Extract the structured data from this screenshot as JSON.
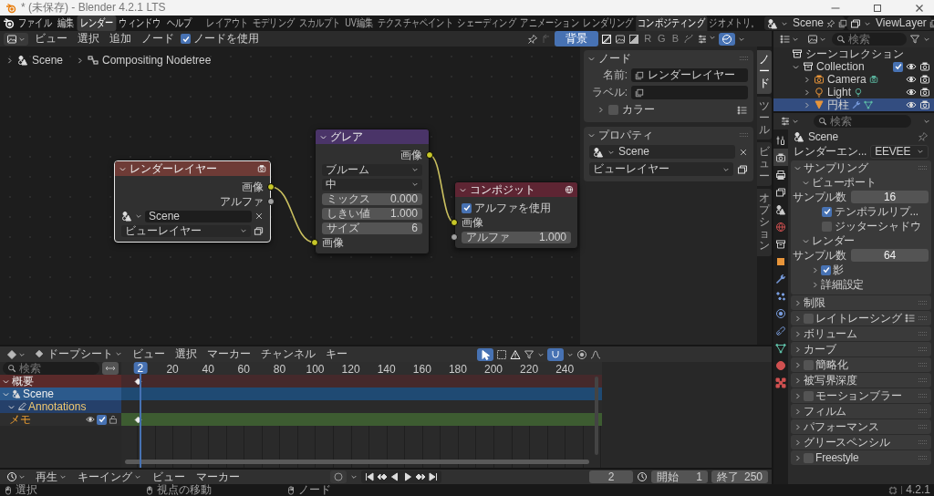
{
  "window": {
    "title": "* (未保存) - Blender 4.2.1 LTS"
  },
  "menu": [
    {
      "label": "ファイル",
      "selected": false
    },
    {
      "label": "編集",
      "selected": false
    },
    {
      "label": "レンダー",
      "selected": true
    },
    {
      "label": "ウィンドウ",
      "selected": false
    },
    {
      "label": "ヘルプ",
      "selected": false
    }
  ],
  "workspaces": [
    {
      "label": "レイアウト",
      "selected": false
    },
    {
      "label": "モデリング",
      "selected": false
    },
    {
      "label": "スカルプト",
      "selected": false
    },
    {
      "label": "UV編集",
      "selected": false
    },
    {
      "label": "テクスチャペイント",
      "selected": false
    },
    {
      "label": "シェーディング",
      "selected": false
    },
    {
      "label": "アニメーション",
      "selected": false
    },
    {
      "label": "レンダリング",
      "selected": false
    },
    {
      "label": "コンポジティング",
      "selected": true
    },
    {
      "label": "ジオメトリ。",
      "selected": false
    }
  ],
  "scene_selector": {
    "value": "Scene"
  },
  "view_layer_selector": {
    "value": "ViewLayer"
  },
  "node_editor": {
    "menu": [
      "ビュー",
      "選択",
      "追加",
      "ノード"
    ],
    "use_nodes": {
      "label": "ノードを使用",
      "checked": true
    },
    "backdrop": {
      "label": "背景",
      "on": true
    },
    "channel_buttons": [
      {
        "label": "R"
      },
      {
        "label": "G"
      },
      {
        "label": "B"
      }
    ],
    "breadcrumbs": [
      "Scene",
      "Compositing Nodetree"
    ],
    "nodes": [
      {
        "kind": "render_layers",
        "title": "レンダーレイヤー",
        "color": "#6e3b36",
        "selected": true,
        "rows": [
          {
            "kind": "output",
            "label": "画像",
            "connected": true,
            "color": "#c7c729"
          },
          {
            "kind": "output",
            "label": "アルファ",
            "connected": false,
            "color": "#a1a1a1"
          },
          {
            "kind": "scene",
            "value": "Scene"
          },
          {
            "kind": "dropdown",
            "value": "ビューレイヤー"
          }
        ]
      },
      {
        "kind": "glare",
        "title": "グレア",
        "color": "#4a3468",
        "selected": false,
        "rows": [
          {
            "kind": "output",
            "label": "画像",
            "connected": true,
            "color": "#c7c729"
          },
          {
            "kind": "dropdown",
            "value": "ブルーム"
          },
          {
            "kind": "dropdown",
            "value": "中"
          },
          {
            "kind": "number",
            "label": "ミックス",
            "value": "0.000"
          },
          {
            "kind": "number",
            "label": "しきい値",
            "value": "1.000"
          },
          {
            "kind": "number",
            "label": "サイズ",
            "value": "6"
          },
          {
            "kind": "input",
            "label": "画像",
            "connected": true,
            "color": "#c7c729"
          }
        ]
      },
      {
        "kind": "composite",
        "title": "コンポジット",
        "color": "#5e2533",
        "selected": false,
        "rows": [
          {
            "kind": "checkbox",
            "label": "アルファを使用",
            "checked": true
          },
          {
            "kind": "input",
            "label": "画像",
            "connected": true,
            "color": "#c7c729"
          },
          {
            "kind": "number_input",
            "label": "アルファ",
            "value": "1.000",
            "color": "#a1a1a1"
          }
        ]
      }
    ]
  },
  "sidebar": {
    "tabs": [
      {
        "label": "ノード",
        "selected": true
      },
      {
        "label": "ツール",
        "selected": false
      },
      {
        "label": "ビュー",
        "selected": false
      },
      {
        "label": "オプション",
        "selected": false
      }
    ],
    "node_panel": {
      "title": "ノード",
      "name_label": "名前:",
      "name": "レンダーレイヤー",
      "label_label": "ラベル:",
      "color_label": "カラー",
      "color_checked": false
    },
    "properties_panel": {
      "title": "プロパティ",
      "scene": "Scene",
      "view_layer": "ビューレイヤー"
    }
  },
  "outliner": {
    "search_placeholder": "検索",
    "root": "シーンコレクション",
    "items": [
      {
        "label": "Collection",
        "kind": "collection",
        "expanded": true,
        "checked": true,
        "selected": false,
        "visible": true,
        "renderable": true,
        "children": [
          {
            "label": "Camera",
            "kind": "camera",
            "expanded": false,
            "selected": false,
            "visible": true,
            "renderable": true
          },
          {
            "label": "Light",
            "kind": "light",
            "expanded": false,
            "selected": false,
            "visible": true,
            "renderable": true
          },
          {
            "label": "円柱",
            "kind": "mesh",
            "expanded": false,
            "selected": true,
            "visible": true,
            "renderable": true
          }
        ]
      }
    ]
  },
  "properties": {
    "search_placeholder": "検索",
    "tabs": [
      {
        "kind": "tool",
        "selected": false
      },
      {
        "kind": "render",
        "selected": true
      },
      {
        "kind": "output",
        "selected": false
      },
      {
        "kind": "view_layer",
        "selected": false
      },
      {
        "kind": "scene",
        "selected": false
      },
      {
        "kind": "world",
        "selected": false
      },
      {
        "kind": "collection",
        "selected": false
      },
      {
        "kind": "object",
        "selected": false
      },
      {
        "kind": "modifiers",
        "selected": false
      },
      {
        "kind": "particles",
        "selected": false
      },
      {
        "kind": "physics",
        "selected": false
      },
      {
        "kind": "constraints",
        "selected": false
      },
      {
        "kind": "data",
        "selected": false
      },
      {
        "kind": "material",
        "selected": false
      },
      {
        "kind": "texture",
        "selected": false
      }
    ],
    "context": "Scene",
    "engine_label": "レンダーエン...",
    "engine": "EEVEE",
    "panels": [
      {
        "kind": "panel",
        "title": "サンプリング",
        "expanded": true,
        "presets": false,
        "children": [
          {
            "kind": "subpanel",
            "title": "ビューポート",
            "expanded": true,
            "children": [
              {
                "kind": "number",
                "label": "サンプル数",
                "value": "16"
              },
              {
                "kind": "checkbox",
                "label": "テンポラルリプ...",
                "checked": true
              },
              {
                "kind": "checkbox",
                "label": "ジッターシャドウ",
                "checked": false
              }
            ]
          },
          {
            "kind": "subpanel",
            "title": "レンダー",
            "expanded": true,
            "children": [
              {
                "kind": "number",
                "label": "サンプル数",
                "value": "64"
              },
              {
                "kind": "subpanel",
                "title": "影",
                "expanded": false,
                "checked": true
              },
              {
                "kind": "subpanel",
                "title": "詳細設定",
                "expanded": false
              }
            ]
          }
        ]
      },
      {
        "kind": "panel",
        "title": "制限",
        "expanded": false,
        "presets": false
      },
      {
        "kind": "panel",
        "title": "レイトレーシング",
        "expanded": false,
        "checked": false,
        "presets": true
      },
      {
        "kind": "panel",
        "title": "ボリューム",
        "expanded": false,
        "presets": false
      },
      {
        "kind": "panel",
        "title": "カーブ",
        "expanded": false,
        "presets": false
      },
      {
        "kind": "panel",
        "title": "簡略化",
        "expanded": false,
        "checked": false,
        "presets": false
      },
      {
        "kind": "panel",
        "title": "被写界深度",
        "expanded": false,
        "presets": false
      },
      {
        "kind": "panel",
        "title": "モーションブラー",
        "expanded": false,
        "checked": false,
        "presets": false
      },
      {
        "kind": "panel",
        "title": "フィルム",
        "expanded": false,
        "presets": false
      },
      {
        "kind": "panel",
        "title": "パフォーマンス",
        "expanded": false,
        "presets": false
      },
      {
        "kind": "panel",
        "title": "グリースペンシル",
        "expanded": false,
        "presets": false
      },
      {
        "kind": "panel",
        "title": "Freestyle",
        "expanded": false,
        "checked": false,
        "presets": false
      }
    ]
  },
  "dopesheet": {
    "mode": "ドープシート",
    "menu": [
      "ビュー",
      "選択",
      "マーカー",
      "チャンネル",
      "キー"
    ],
    "search_placeholder": "検索",
    "current_frame": "2",
    "ticks": [
      "20",
      "40",
      "60",
      "80",
      "100",
      "120",
      "140",
      "160",
      "180",
      "200",
      "220",
      "240"
    ],
    "channels": [
      {
        "kind": "summary",
        "label": "概要",
        "expanded": true,
        "keyed": true
      },
      {
        "kind": "scene",
        "label": "Scene",
        "expanded": true,
        "keyed": false
      },
      {
        "kind": "annotations",
        "label": "Annotations",
        "expanded": true,
        "keyed": false
      },
      {
        "kind": "layer",
        "label": "メモ",
        "keyed": true,
        "visible": true,
        "checked": true
      }
    ]
  },
  "timeline": {
    "menu": [
      {
        "label": "再生",
        "dropdown": true
      },
      {
        "label": "キーイング",
        "dropdown": true
      },
      {
        "label": "ビュー",
        "dropdown": false
      },
      {
        "label": "マーカー",
        "dropdown": false
      }
    ],
    "frame": "2",
    "start_label": "開始",
    "start": "1",
    "end_label": "終了",
    "end": "250"
  },
  "status_bar": {
    "items": [
      {
        "kind": "left_click",
        "label": "選択"
      },
      {
        "kind": "middle_click",
        "label": "視点の移動"
      },
      {
        "kind": "right_click",
        "label": "ノード"
      }
    ],
    "version": "4.2.1"
  }
}
